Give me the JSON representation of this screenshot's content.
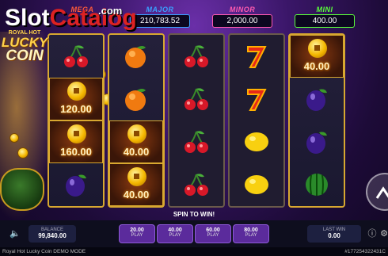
{
  "watermark": {
    "slot": "Slot",
    "catalog": "Catalog",
    "com": ".com"
  },
  "logo": {
    "line1": "ROYAL HOT",
    "line2": "LUCKY",
    "line3": "COIN"
  },
  "jackpots": [
    {
      "name": "MEGA",
      "value": "",
      "color": "#ff5a3a"
    },
    {
      "name": "MAJOR",
      "value": "210,783.52",
      "color": "#3aa0ff"
    },
    {
      "name": "MINOR",
      "value": "2,000.00",
      "color": "#ff5ab0"
    },
    {
      "name": "MINI",
      "value": "400.00",
      "color": "#5aff3a"
    }
  ],
  "reels": [
    [
      "cherry",
      "coin:120.00",
      "coin:160.00",
      "plum"
    ],
    [
      "orange",
      "orange",
      "coin:40.00",
      "coin:40.00"
    ],
    [
      "cherry",
      "cherry",
      "cherry",
      "cherry"
    ],
    [
      "seven",
      "seven",
      "lemon",
      "lemon"
    ],
    [
      "coin:40.00",
      "plum",
      "plum",
      "watermelon"
    ]
  ],
  "spin_to_win": "SPIN TO WIN!",
  "balance": {
    "label": "BALANCE",
    "value": "99,840.00"
  },
  "bets": [
    {
      "value": "20.00",
      "label": "PLAY"
    },
    {
      "value": "40.00",
      "label": "PLAY"
    },
    {
      "value": "60.00",
      "label": "PLAY"
    },
    {
      "value": "80.00",
      "label": "PLAY"
    }
  ],
  "last_win": {
    "label": "LAST WIN",
    "value": "0.00"
  },
  "footer": {
    "title": "Royal Hot Lucky Coin DEMO MODE",
    "id": "#177254322431C"
  },
  "icons": {
    "sound": "speaker-icon",
    "help": "info-icon",
    "settings": "gear-icon",
    "spin": "spin-arrow-icon"
  }
}
